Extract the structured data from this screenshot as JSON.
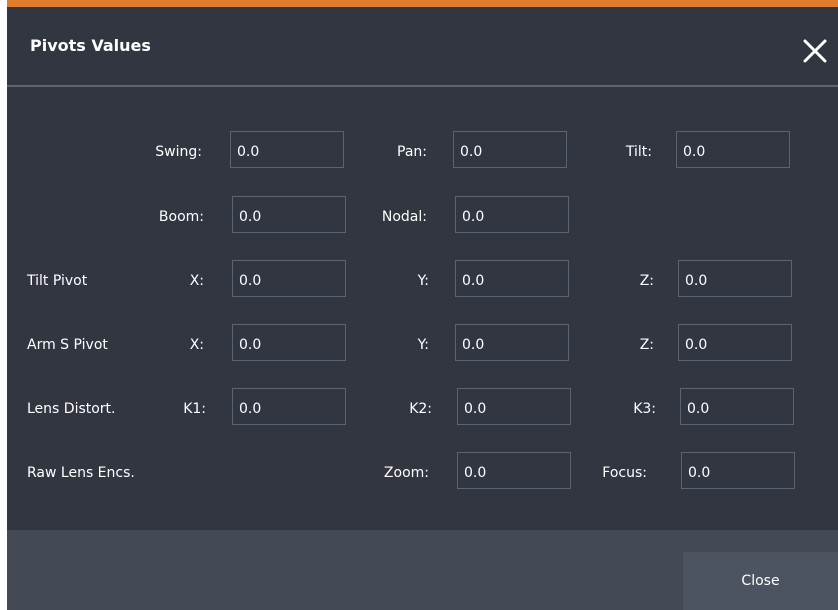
{
  "dialog": {
    "title": "Pivots Values",
    "close_button_label": "Close"
  },
  "colors": {
    "accent": "#e07d2c",
    "background": "#313640",
    "footer": "#434955",
    "button": "#4d5461",
    "field_border": "#5b6270"
  },
  "rows": {
    "swing": {
      "label": "Swing:",
      "value": "0.0"
    },
    "pan": {
      "label": "Pan:",
      "value": "0.0"
    },
    "tilt": {
      "label": "Tilt:",
      "value": "0.0"
    },
    "boom": {
      "label": "Boom:",
      "value": "0.0"
    },
    "nodal": {
      "label": "Nodal:",
      "value": "0.0"
    },
    "tilt_pivot": {
      "label": "Tilt Pivot",
      "x_label": "X:",
      "x": "0.0",
      "y_label": "Y:",
      "y": "0.0",
      "z_label": "Z:",
      "z": "0.0"
    },
    "arm_s_pivot": {
      "label": "Arm S Pivot",
      "x_label": "X:",
      "x": "0.0",
      "y_label": "Y:",
      "y": "0.0",
      "z_label": "Z:",
      "z": "0.0"
    },
    "lens_distort": {
      "label": "Lens Distort.",
      "k1_label": "K1:",
      "k1": "0.0",
      "k2_label": "K2:",
      "k2": "0.0",
      "k3_label": "K3:",
      "k3": "0.0"
    },
    "raw_lens_encs": {
      "label": "Raw Lens Encs.",
      "zoom_label": "Zoom:",
      "zoom": "0.0",
      "focus_label": "Focus:",
      "focus": "0.0"
    }
  }
}
